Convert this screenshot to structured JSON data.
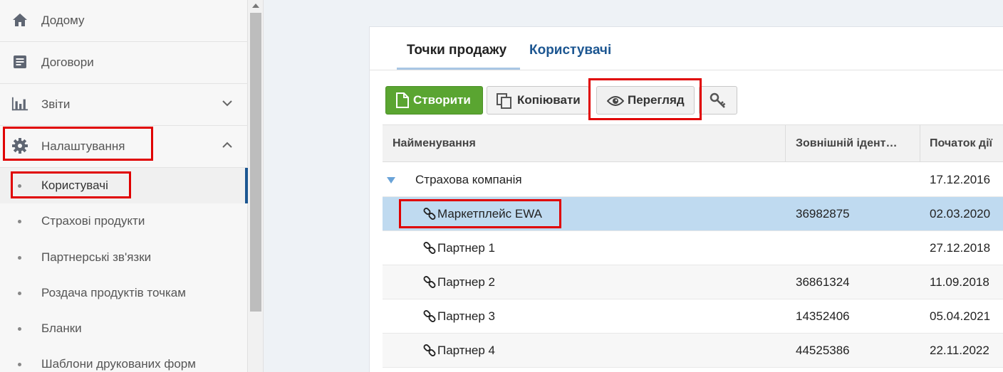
{
  "sidebar": {
    "items": [
      {
        "label": "Додому",
        "icon": "home-icon"
      },
      {
        "label": "Договори",
        "icon": "document-icon"
      },
      {
        "label": "Звіти",
        "icon": "bar-chart-icon"
      },
      {
        "label": "Налаштування",
        "icon": "gear-icon"
      }
    ],
    "subitems": [
      {
        "label": "Користувачі"
      },
      {
        "label": "Страхові продукти"
      },
      {
        "label": "Партнерські зв'язки"
      },
      {
        "label": "Роздача продуктів точкам"
      },
      {
        "label": "Бланки"
      },
      {
        "label": "Шаблони друкованих форм"
      }
    ]
  },
  "tabs": [
    {
      "label": "Точки продажу"
    },
    {
      "label": "Користувачі"
    }
  ],
  "toolbar": {
    "create_label": "Створити",
    "copy_label": "Копіювати",
    "view_label": "Перегляд"
  },
  "table": {
    "columns": [
      "Найменування",
      "Зовнішній ідент…",
      "Початок дії"
    ],
    "rows": [
      {
        "name": "Страхова компанія",
        "ext_id": "",
        "start": "17.12.2016"
      },
      {
        "name": "Маркетплейс EWA",
        "ext_id": "36982875",
        "start": "02.03.2020"
      },
      {
        "name": "Партнер 1",
        "ext_id": "",
        "start": "27.12.2018"
      },
      {
        "name": "Партнер 2",
        "ext_id": "36861324",
        "start": "11.09.2018"
      },
      {
        "name": "Партнер 3",
        "ext_id": "14352406",
        "start": "05.04.2021"
      },
      {
        "name": "Партнер 4",
        "ext_id": "44525386",
        "start": "22.11.2022"
      }
    ]
  },
  "colors": {
    "accent": "#1c5691",
    "create_button": "#5aa531",
    "selected_row": "#bfdaf0",
    "highlight": "#e00000"
  }
}
